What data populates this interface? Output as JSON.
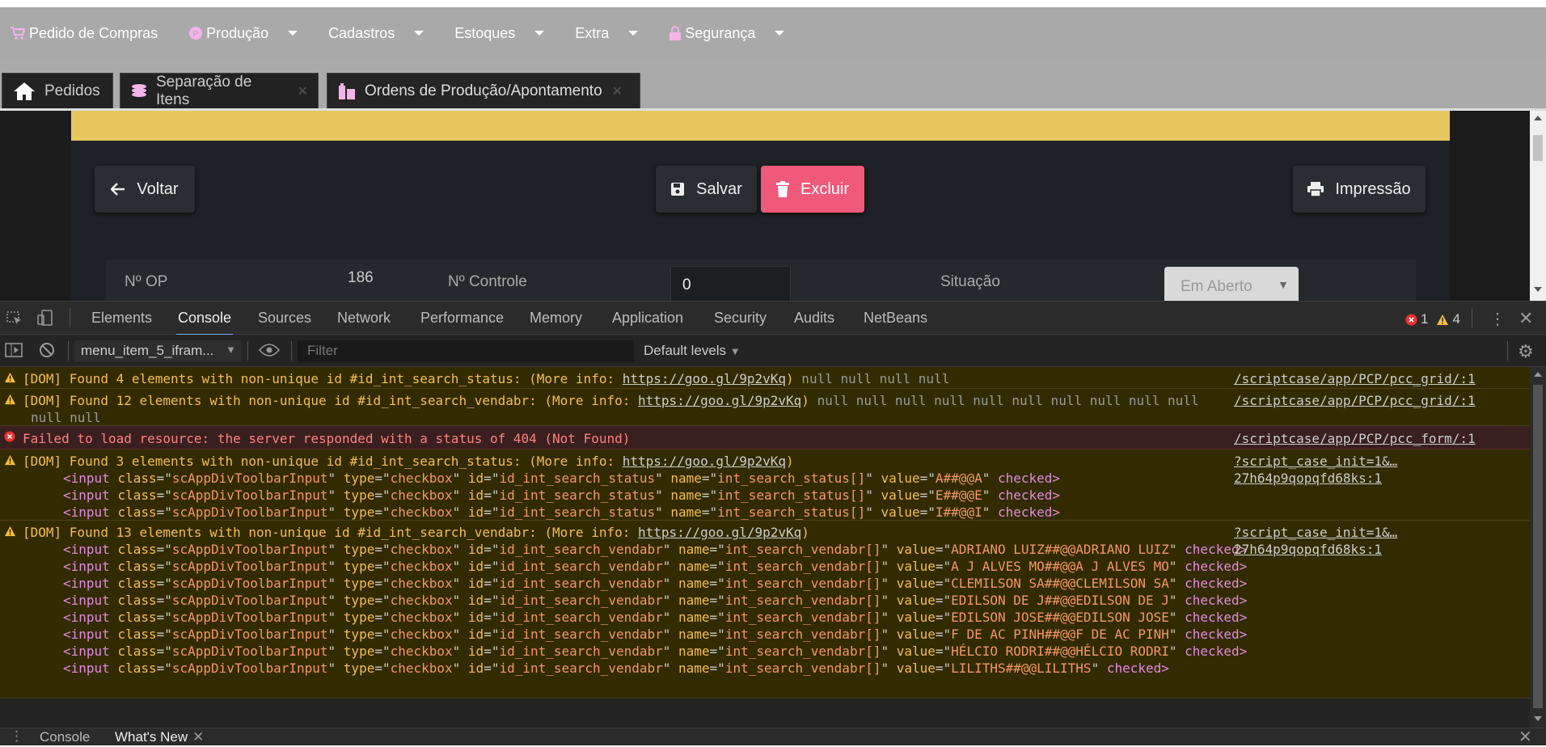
{
  "menu": {
    "items": [
      {
        "label": "Pedido de Compras",
        "icon": "cart-icon",
        "has_caret": false
      },
      {
        "label": "Produção",
        "icon": "production-icon",
        "has_caret": true
      },
      {
        "label": "Cadastros",
        "icon": "",
        "has_caret": true
      },
      {
        "label": "Estoques",
        "icon": "",
        "has_caret": true
      },
      {
        "label": "Extra",
        "icon": "",
        "has_caret": true
      },
      {
        "label": "Segurança",
        "icon": "lock-icon",
        "has_caret": true
      }
    ]
  },
  "tabs": [
    {
      "label": "Pedidos",
      "icon": "home-icon"
    },
    {
      "label": "Separação de Itens",
      "icon": "coins-icon"
    },
    {
      "label": "Ordens de Produção/Apontamento",
      "icon": "building-icon"
    }
  ],
  "form": {
    "buttons": {
      "back": "Voltar",
      "save": "Salvar",
      "delete": "Excluir",
      "print": "Impressão"
    },
    "fields": {
      "op_label": "Nº OP",
      "op_value": "186",
      "control_label": "Nº Controle",
      "control_value": "0",
      "status_label": "Situação",
      "status_value": "Em Aberto"
    }
  },
  "devtools": {
    "tabs": [
      "Elements",
      "Console",
      "Sources",
      "Network",
      "Performance",
      "Memory",
      "Application",
      "Security",
      "Audits",
      "NetBeans"
    ],
    "active_tab": "Console",
    "error_count": "1",
    "warning_count": "4",
    "context": "menu_item_5_ifram...",
    "filter_placeholder": "Filter",
    "levels": "Default levels",
    "drawer_tabs": [
      "Console",
      "What's New"
    ]
  },
  "console": {
    "messages": [
      {
        "type": "warn",
        "text": "[DOM] Found 4 elements with non-unique id #id_int_search_status: (More info: ",
        "link": "https://goo.gl/9p2vKq",
        "tail": ")",
        "nulls": " null null null null",
        "source": "/scriptcase/app/PCP/pcc_grid/:1"
      },
      {
        "type": "warn",
        "text": "[DOM] Found 12 elements with non-unique id #id_int_search_vendabr: (More info: ",
        "link": "https://goo.gl/9p2vKq",
        "tail": ")",
        "nulls": " null null null null null null null null null null",
        "nulls2": "null null",
        "source": "/scriptcase/app/PCP/pcc_grid/:1"
      },
      {
        "type": "err",
        "text": "Failed to load resource: the server responded with a status of 404 (Not Found)",
        "source": "/scriptcase/app/PCP/pcc_form/:1"
      },
      {
        "type": "warn",
        "text": "[DOM] Found 3 elements with non-unique id #id_int_search_status: (More info: ",
        "link": "https://goo.gl/9p2vKq",
        "tail": ")",
        "source": "?script_case_init=1&…27h64p9qopqfd68ks:1"
      },
      {
        "type": "warn",
        "text": "[DOM] Found 13 elements with non-unique id #id_int_search_vendabr: (More info: ",
        "link": "https://goo.gl/9p2vKq",
        "tail": ")",
        "source": "?script_case_init=1&…27h64p9qopqfd68ks:1"
      }
    ],
    "status_inputs": [
      {
        "id": "id_int_search_status",
        "name": "int_search_status[]",
        "value": "A##@@A"
      },
      {
        "id": "id_int_search_status",
        "name": "int_search_status[]",
        "value": "E##@@E"
      },
      {
        "id": "id_int_search_status",
        "name": "int_search_status[]",
        "value": "I##@@I"
      }
    ],
    "vendabr_inputs": [
      {
        "id": "id_int_search_vendabr",
        "name": "int_search_vendabr[]",
        "value": "ADRIANO LUIZ##@@ADRIANO LUIZ"
      },
      {
        "id": "id_int_search_vendabr",
        "name": "int_search_vendabr[]",
        "value": "A J ALVES MO##@@A J ALVES MO"
      },
      {
        "id": "id_int_search_vendabr",
        "name": "int_search_vendabr[]",
        "value": "CLEMILSON SA##@@CLEMILSON SA"
      },
      {
        "id": "id_int_search_vendabr",
        "name": "int_search_vendabr[]",
        "value": "EDILSON DE J##@@EDILSON DE J"
      },
      {
        "id": "id_int_search_vendabr",
        "name": "int_search_vendabr[]",
        "value": "EDILSON JOSE##@@EDILSON JOSE"
      },
      {
        "id": "id_int_search_vendabr",
        "name": "int_search_vendabr[]",
        "value": "F DE AC PINH##@@F DE AC PINH"
      },
      {
        "id": "id_int_search_vendabr",
        "name": "int_search_vendabr[]",
        "value": "HÉLCIO RODRI##@@HÉLCIO RODRI"
      },
      {
        "id": "id_int_search_vendabr",
        "name": "int_search_vendabr[]",
        "value": "LILITHS##@@LILITHS"
      }
    ],
    "input_class": "scAppDivToolbarInput",
    "input_type": "checkbox"
  }
}
